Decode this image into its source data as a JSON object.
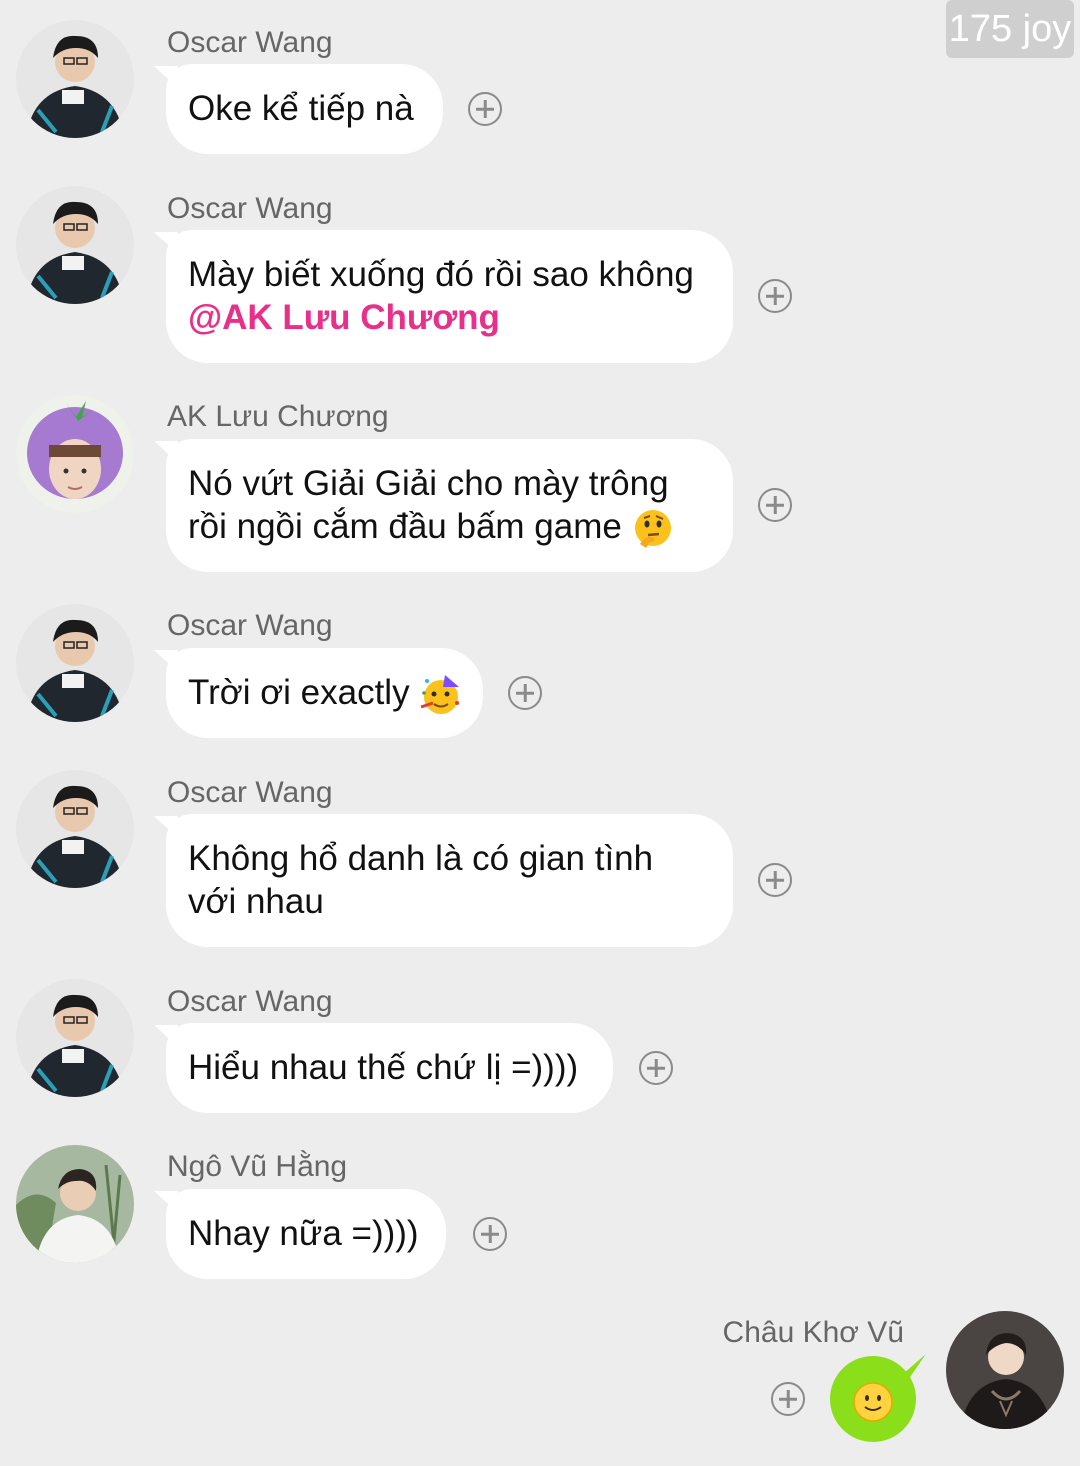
{
  "watermark": "175 joy",
  "messages": [
    {
      "sender": "Oscar Wang",
      "text": "Oke kể tiếp nà"
    },
    {
      "sender": "Oscar Wang",
      "text": "Mày biết xuống đó rồi sao không",
      "mention": "@AK Lưu Chương"
    },
    {
      "sender": "AK Lưu Chương",
      "line1": "Nó vứt Giải Giải cho mày trông",
      "line2": "rồi ngồi cắm đầu bấm game",
      "emoji": "thinking-face-emoji"
    },
    {
      "sender": "Oscar Wang",
      "text": "Trời ơi exactly",
      "emoji": "partying-face-emoji"
    },
    {
      "sender": "Oscar Wang",
      "line1": "Không hổ danh là có gian tình",
      "line2": "với nhau"
    },
    {
      "sender": "Oscar Wang",
      "text": "Hiểu nhau thế chứ lị =))))"
    },
    {
      "sender": "Ngô Vũ Hằng",
      "text": "Nhay nữa =))))"
    },
    {
      "sender": "Châu Khơ Vũ",
      "sticker": "smiling-face-sticker",
      "own": true
    }
  ],
  "colors": {
    "background": "#ededed",
    "bubble": "#ffffff",
    "own_bubble": "#8bde1a",
    "mention": "#e8308b",
    "sender_name": "#666666"
  },
  "icons": {
    "react": "plus-circle-icon"
  }
}
